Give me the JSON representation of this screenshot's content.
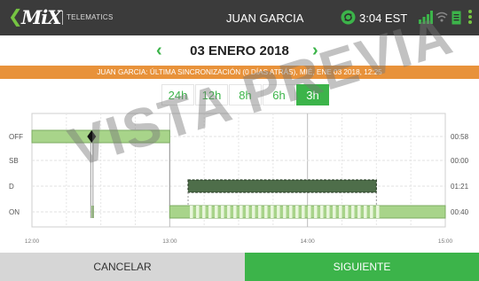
{
  "topbar": {
    "logo_text": "MiX",
    "brand_sub": "TELEMATICS",
    "driver_name": "JUAN GARCIA",
    "time": "3:04 EST",
    "icons": [
      "back-chevron-icon",
      "sync-icon",
      "signal-icon",
      "wifi-icon",
      "document-icon",
      "kebab-menu-icon"
    ]
  },
  "date_nav": {
    "prev": "‹",
    "title": "03 ENERO 2018",
    "next": "›"
  },
  "sync_banner": "JUAN GARCIA: ÚLTIMA SINCRONIZACIÓN (0 DÍAS ATRÁS), MIÉ, ENE 03 2018, 12:25",
  "zoom_tabs": [
    {
      "label": "24h",
      "active": false
    },
    {
      "label": "12h",
      "active": false
    },
    {
      "label": "8h",
      "active": false
    },
    {
      "label": "6h",
      "active": false
    },
    {
      "label": "3h",
      "active": true
    }
  ],
  "chart_data": {
    "type": "line",
    "title": "",
    "xlabel": "",
    "ylabel": "",
    "rows": [
      "OFF",
      "SB",
      "D",
      "ON"
    ],
    "totals": [
      "00:58",
      "00:00",
      "01:21",
      "00:40"
    ],
    "x_ticks": [
      "12:00",
      "13:00",
      "14:00",
      "15:00"
    ],
    "xlim": [
      "12:00",
      "15:00"
    ],
    "segments": [
      {
        "status": "OFF",
        "start": "12:00",
        "end": "13:00"
      },
      {
        "status": "ON",
        "start": "12:26",
        "end": "12:27"
      },
      {
        "status": "ON",
        "start": "13:00",
        "end": "15:00"
      },
      {
        "status": "D",
        "start": "13:08",
        "end": "14:30"
      }
    ],
    "marker": {
      "status": "OFF",
      "time": "12:26"
    }
  },
  "watermark": "VISTA PREVIA",
  "footer": {
    "cancel": "CANCELAR",
    "next": "SIGUIENTE"
  },
  "colors": {
    "topbar": "#3b3b3b",
    "accent_green": "#3cb44a",
    "banner_orange": "#e8923a",
    "off_fill": "#a8d48a",
    "drive_fill": "#4e6e4a",
    "cancel_bg": "#d6d6d6"
  }
}
